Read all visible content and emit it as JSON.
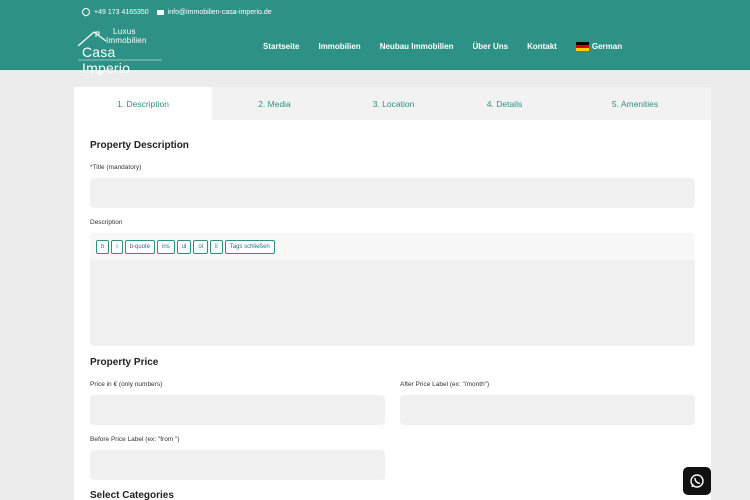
{
  "header": {
    "phone": "+49 173 4165350",
    "email": "info@immobilien-casa-imperio.de",
    "logo": {
      "line1": "Luxus",
      "line2": "Immobilien",
      "line3": "Casa Imperio"
    },
    "nav": [
      "Startseite",
      "Immobilien",
      "Neubau Immobilien",
      "Über Uns",
      "Kontakt"
    ],
    "language": "German",
    "colors": {
      "header_bg": "#2e9186",
      "accent": "#2e9186"
    }
  },
  "tabs": [
    {
      "label": "1. Description",
      "active": true
    },
    {
      "label": "2. Media",
      "active": false
    },
    {
      "label": "3. Location",
      "active": false
    },
    {
      "label": "4. Details",
      "active": false
    },
    {
      "label": "5. Amenities",
      "active": false
    }
  ],
  "form": {
    "property_description_title": "Property Description",
    "title_label": "*Title (mandatory)",
    "title_value": "",
    "description_label": "Description",
    "editor_buttons": [
      "b",
      "i",
      "b-quote",
      "ins",
      "ul",
      "ol",
      "li",
      "Tags schließen"
    ],
    "property_price_title": "Property Price",
    "price_label": "Price in € (only numbers)",
    "after_price_label": "After Price Label (ex: \"/month\")",
    "before_price_label": "Before Price Label (ex: \"from \")",
    "select_categories_title": "Select Categories"
  },
  "floating": {
    "icon": "whatsapp-icon"
  }
}
